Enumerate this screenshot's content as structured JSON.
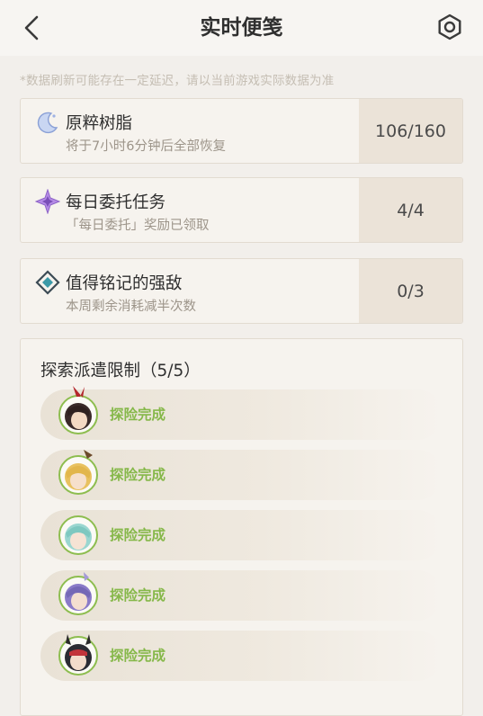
{
  "header": {
    "title": "实时便笺",
    "back_icon": "chevron-left-icon",
    "settings_icon": "gear-icon"
  },
  "notice": "*数据刷新可能存在一定延迟，请以当前游戏实际数据为准",
  "cards": [
    {
      "name": "原粹树脂",
      "sub": "将于7小时6分钟后全部恢复",
      "value": "106/160",
      "icon": "moon-resin-icon"
    },
    {
      "name": "每日委托任务",
      "sub": "「每日委托」奖励已领取",
      "value": "4/4",
      "icon": "commission-star-icon"
    },
    {
      "name": "值得铭记的强敌",
      "sub": "本周剩余消耗减半次数",
      "value": "0/3",
      "icon": "domain-diamond-icon"
    }
  ],
  "expedition": {
    "title": "探索派遣限制（5/5）",
    "items": [
      {
        "status": "探险完成",
        "avatar": "character-avatar-red-ribbon"
      },
      {
        "status": "探险完成",
        "avatar": "character-avatar-blonde"
      },
      {
        "status": "探险完成",
        "avatar": "character-avatar-teal"
      },
      {
        "status": "探险完成",
        "avatar": "character-avatar-purple"
      },
      {
        "status": "探险完成",
        "avatar": "character-avatar-dark-horned"
      }
    ]
  },
  "colors": {
    "accent_green": "#86b84a",
    "background": "#f2efeb",
    "card_value_bg": "#ebe3d8"
  }
}
